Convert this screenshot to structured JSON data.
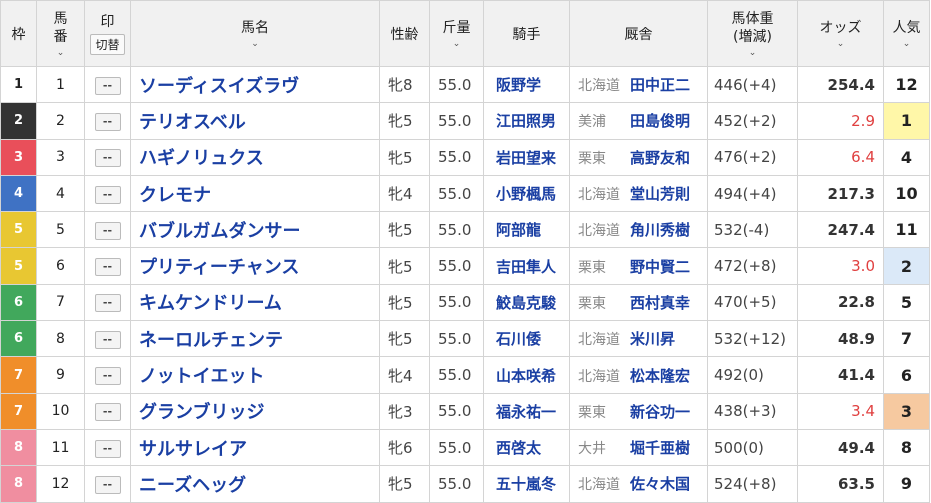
{
  "header": {
    "waku": "枠",
    "umaban_1": "馬",
    "umaban_2": "番",
    "mark": "印",
    "toggle": "切替",
    "horse": "馬名",
    "sex_age": "性齢",
    "kinryo": "斤量",
    "jockey": "騎手",
    "stable": "厩舎",
    "weight_1": "馬体重",
    "weight_2": "(増減)",
    "odds": "オッズ",
    "popularity": "人気",
    "sort_icon": "chevron-down-icon"
  },
  "mark_placeholder": "--",
  "rows": [
    {
      "waku": "1",
      "umaban": "1",
      "horse": "ソーディスイズラヴ",
      "sex_age": "牝8",
      "kinryo": "55.0",
      "jockey": "阪野学",
      "region": "北海道",
      "trainer": "田中正二",
      "weight": "446(+4)",
      "odds": "254.4",
      "pop": "12"
    },
    {
      "waku": "2",
      "umaban": "2",
      "horse": "テリオスベル",
      "sex_age": "牝5",
      "kinryo": "55.0",
      "jockey": "江田照男",
      "region": "美浦",
      "trainer": "田島俊明",
      "weight": "452(+2)",
      "odds": "2.9",
      "pop": "1"
    },
    {
      "waku": "3",
      "umaban": "3",
      "horse": "ハギノリュクス",
      "sex_age": "牝5",
      "kinryo": "55.0",
      "jockey": "岩田望来",
      "region": "栗東",
      "trainer": "高野友和",
      "weight": "476(+2)",
      "odds": "6.4",
      "pop": "4"
    },
    {
      "waku": "4",
      "umaban": "4",
      "horse": "クレモナ",
      "sex_age": "牝4",
      "kinryo": "55.0",
      "jockey": "小野楓馬",
      "region": "北海道",
      "trainer": "堂山芳則",
      "weight": "494(+4)",
      "odds": "217.3",
      "pop": "10"
    },
    {
      "waku": "5",
      "umaban": "5",
      "horse": "バブルガムダンサー",
      "sex_age": "牝5",
      "kinryo": "55.0",
      "jockey": "阿部龍",
      "region": "北海道",
      "trainer": "角川秀樹",
      "weight": "532(-4)",
      "odds": "247.4",
      "pop": "11"
    },
    {
      "waku": "5",
      "umaban": "6",
      "horse": "プリティーチャンス",
      "sex_age": "牝5",
      "kinryo": "55.0",
      "jockey": "吉田隼人",
      "region": "栗東",
      "trainer": "野中賢二",
      "weight": "472(+8)",
      "odds": "3.0",
      "pop": "2"
    },
    {
      "waku": "6",
      "umaban": "7",
      "horse": "キムケンドリーム",
      "sex_age": "牝5",
      "kinryo": "55.0",
      "jockey": "鮫島克駿",
      "region": "栗東",
      "trainer": "西村真幸",
      "weight": "470(+5)",
      "odds": "22.8",
      "pop": "5"
    },
    {
      "waku": "6",
      "umaban": "8",
      "horse": "ネーロルチェンテ",
      "sex_age": "牝5",
      "kinryo": "55.0",
      "jockey": "石川倭",
      "region": "北海道",
      "trainer": "米川昇",
      "weight": "532(+12)",
      "odds": "48.9",
      "pop": "7"
    },
    {
      "waku": "7",
      "umaban": "9",
      "horse": "ノットイエット",
      "sex_age": "牝4",
      "kinryo": "55.0",
      "jockey": "山本咲希",
      "region": "北海道",
      "trainer": "松本隆宏",
      "weight": "492(0)",
      "odds": "41.4",
      "pop": "6"
    },
    {
      "waku": "7",
      "umaban": "10",
      "horse": "グランブリッジ",
      "sex_age": "牝3",
      "kinryo": "55.0",
      "jockey": "福永祐一",
      "region": "栗東",
      "trainer": "新谷功一",
      "weight": "438(+3)",
      "odds": "3.4",
      "pop": "3"
    },
    {
      "waku": "8",
      "umaban": "11",
      "horse": "サルサレイア",
      "sex_age": "牝6",
      "kinryo": "55.0",
      "jockey": "西啓太",
      "region": "大井",
      "trainer": "堀千亜樹",
      "weight": "500(0)",
      "odds": "49.4",
      "pop": "8"
    },
    {
      "waku": "8",
      "umaban": "12",
      "horse": "ニーズヘッグ",
      "sex_age": "牝5",
      "kinryo": "55.0",
      "jockey": "五十嵐冬",
      "region": "北海道",
      "trainer": "佐々木国",
      "weight": "524(+8)",
      "odds": "63.5",
      "pop": "9"
    }
  ]
}
